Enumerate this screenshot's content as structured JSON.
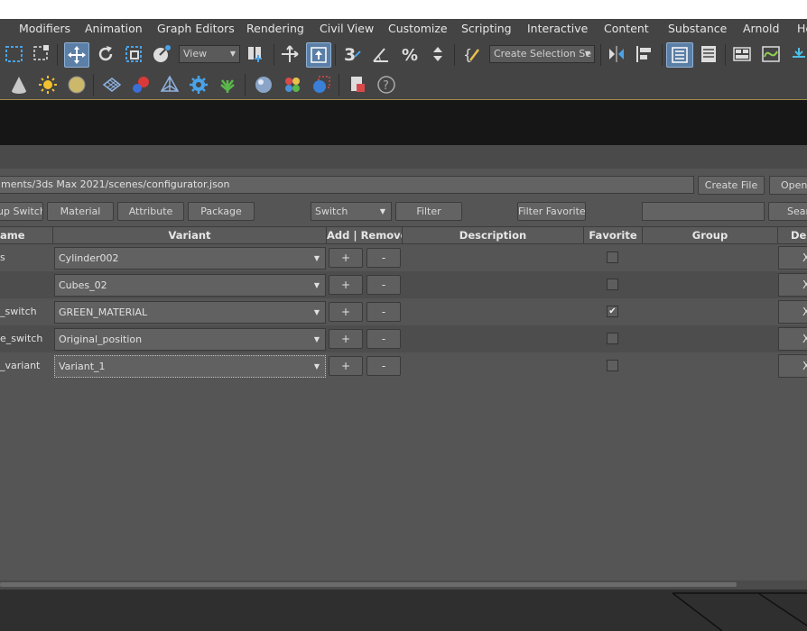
{
  "menu": {
    "items": [
      "Modifiers",
      "Animation",
      "Graph Editors",
      "Rendering",
      "Civil View",
      "Customize",
      "Scripting",
      "Interactive",
      "Content",
      "Substance",
      "Arnold",
      "He"
    ]
  },
  "toolbar": {
    "view_dropdown": "View",
    "selection_set_dropdown": "Create Selection Se"
  },
  "panel": {
    "path_value": "ments/3ds Max 2021/scenes/configurator.json",
    "create_file_label": "Create File",
    "open_label": "Open",
    "group_switch_label": "up Switch",
    "material_label": "Material",
    "attribute_label": "Attribute",
    "package_label": "Package",
    "type_filter_value": "Switch",
    "filter_label": "Filter",
    "filter_favorite_label": "Filter Favorite",
    "search_value": "",
    "search_label": "Sear"
  },
  "table": {
    "headers": {
      "name": "ame",
      "variant": "Variant",
      "add_remove": "Add | Remove",
      "description": "Description",
      "favorite": "Favorite",
      "group": "Group",
      "delete": "Del"
    },
    "rows": [
      {
        "name": "s",
        "variant": "Cylinder002",
        "favorite": false,
        "add": "+",
        "remove": "-",
        "delete": "X"
      },
      {
        "name": "",
        "variant": "Cubes_02",
        "favorite": false,
        "add": "+",
        "remove": "-",
        "delete": "X"
      },
      {
        "name": "_switch",
        "variant": "GREEN_MATERIAL",
        "favorite": true,
        "add": "+",
        "remove": "-",
        "delete": "X"
      },
      {
        "name": "e_switch",
        "variant": "Original_position",
        "favorite": false,
        "add": "+",
        "remove": "-",
        "delete": "X"
      },
      {
        "name": "_variant",
        "variant": "Variant_1",
        "favorite": false,
        "add": "+",
        "remove": "-",
        "delete": "X"
      }
    ]
  },
  "colors": {
    "background": "#444444",
    "panel": "#555555",
    "accent": "#5b7fa6"
  },
  "icons": [
    "select-region-icon",
    "window-crossing-icon",
    "move-icon",
    "rotate-icon",
    "scale-icon",
    "placement-icon",
    "pivot-icon",
    "snap-icon",
    "angle-snap-icon",
    "percent-snap-icon",
    "spinner-snap-icon",
    "named-selection-icon",
    "mirror-icon",
    "align-icon",
    "scene-explorer-icon",
    "layer-explorer-icon",
    "ribbon-icon",
    "curve-editor-icon",
    "schematic-icon",
    "cone-icon",
    "sun-icon",
    "sphere-light-icon",
    "grid-icon",
    "molecule-icon",
    "pyramid-icon",
    "gear-icon",
    "plant-icon",
    "material-sphere-icon",
    "material-editor-icon",
    "render-icon",
    "render-frame-icon",
    "help-icon"
  ]
}
